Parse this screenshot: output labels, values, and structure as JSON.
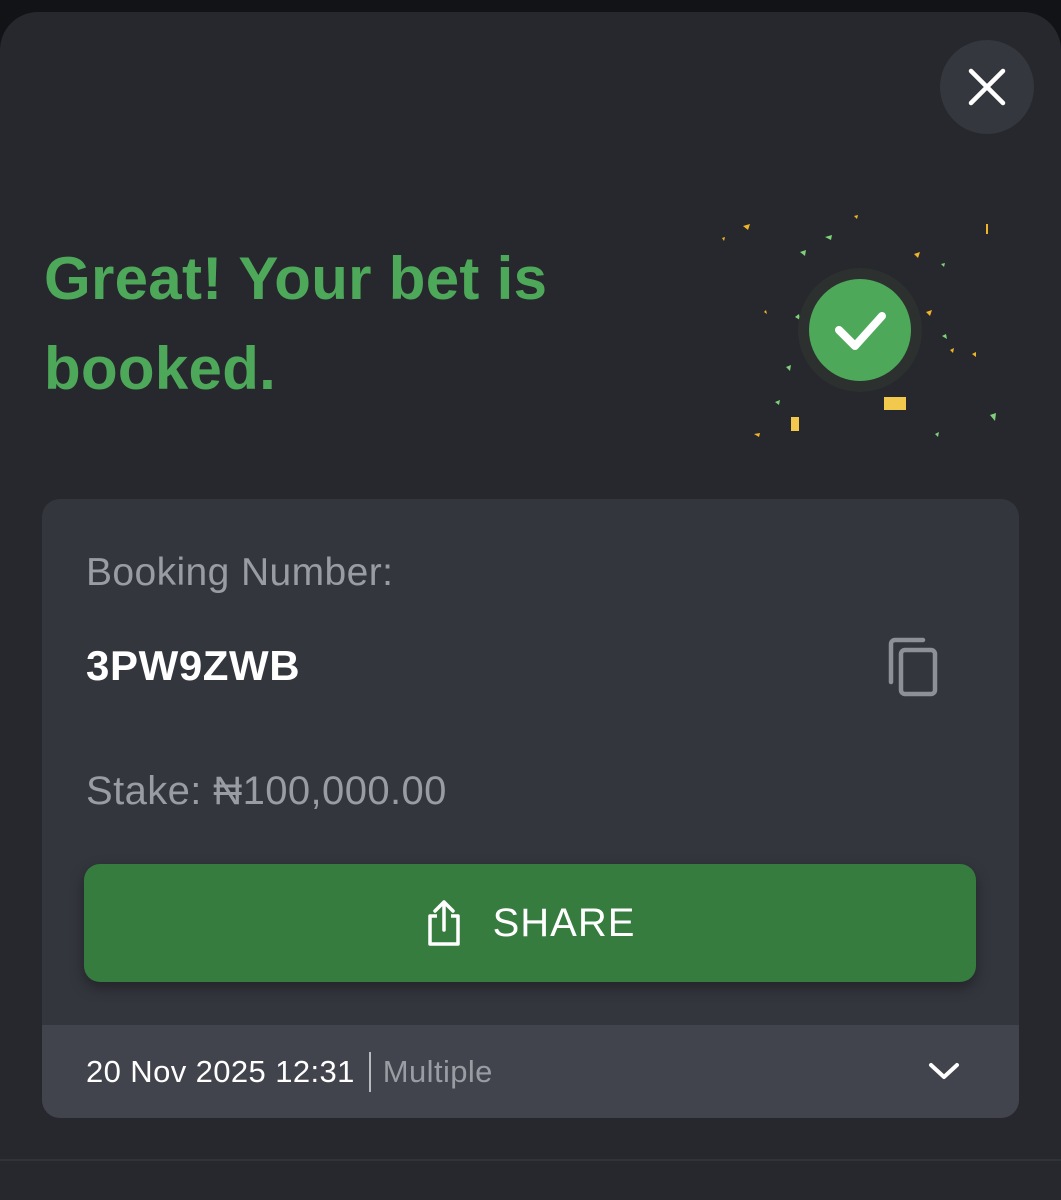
{
  "header": {
    "title": "Great! Your bet is booked.",
    "close_icon": "close-icon"
  },
  "success_badge": {
    "icon": "checkmark-icon",
    "confetti_colors": [
      "#f0b429",
      "#7fd17a",
      "#f2c94c"
    ]
  },
  "booking": {
    "label": "Booking Number:",
    "code": "3PW9ZWB",
    "copy_icon": "copy-icon"
  },
  "stake": {
    "text": "Stake: ₦100,000.00"
  },
  "share": {
    "label": "SHARE",
    "icon": "share-icon"
  },
  "footer": {
    "datetime": "20 Nov 2025 12:31",
    "bet_type": "Multiple",
    "expand_icon": "chevron-down-icon"
  },
  "colors": {
    "accent_green": "#4ea85a",
    "button_green": "#367c3f",
    "sheet_bg": "#26282d",
    "card_bg": "#34363e"
  }
}
